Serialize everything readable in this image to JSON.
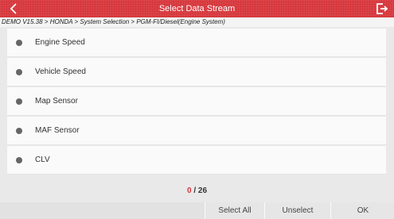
{
  "header": {
    "title": "Select Data Stream",
    "color": "#d6373c",
    "back_icon": "chevron-left-icon",
    "exit_icon": "exit-icon"
  },
  "breadcrumb": "DEMO V15.38 > HONDA > System Selection > PGM-FI/Diesel(Engine System)",
  "items": [
    {
      "label": "Engine Speed"
    },
    {
      "label": "Vehicle Speed"
    },
    {
      "label": "Map Sensor"
    },
    {
      "label": "MAF Sensor"
    },
    {
      "label": "CLV"
    }
  ],
  "counter": {
    "selected": "0",
    "total": "/ 26"
  },
  "footer": {
    "select_all": "Select All",
    "unselect": "Unselect",
    "ok": "OK"
  }
}
